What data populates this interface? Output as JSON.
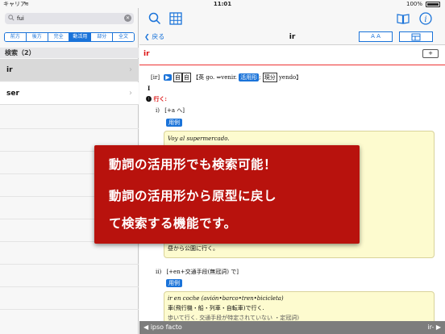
{
  "status": {
    "carrier": "キャリア",
    "time": "11:01",
    "battery": "100%"
  },
  "search": {
    "value": "fui",
    "placeholder": ""
  },
  "segments": [
    "前方",
    "後方",
    "完全",
    "動活用",
    "部分",
    "全文"
  ],
  "results": {
    "header": "検索（2）",
    "items": [
      "ir",
      "ser"
    ]
  },
  "nav": {
    "back": "戻る",
    "title": "ir",
    "font_button": "A A"
  },
  "entry": {
    "headword": "ir",
    "pron": "[ir]",
    "line1_tail": "【英 go. ⇔venir.",
    "conj_tag": "活用形",
    "gen_tag": "現分",
    "gen_form": "yendo】",
    "marker": "I",
    "sense1_num": "❶",
    "sense1": "行く:",
    "sub_i": "i)",
    "sub_i_pattern": "[+a へ]",
    "example_btn": "用例",
    "example1_es": "Voy al supermercado.",
    "example_hidden": "昼から公園に行く。",
    "sub_ii": "ii)",
    "sub_ii_pattern": "[+en+交通手段(無冠詞) で]",
    "example2_es": "ir en coche (avión•barco•tren•bicicleta)",
    "example2_jp": "車(飛行機・船・列車・自転車)で行く.",
    "example3_partial": "歩いて行く. 交通手段が特定されていない ・定冠詞)"
  },
  "bottom": {
    "prev": "◀ ipso facto",
    "next": "ir- ▶"
  },
  "overlay": {
    "line1": "動詞の活用形でも検索可能！",
    "line2": "動詞の活用形から原型に戻し",
    "line3": "て検索する機能です。"
  },
  "colors": {
    "accent": "#1a73d9",
    "headword": "#d11111",
    "overlay": "#b8120d",
    "example_bg": "#fdfbcf"
  }
}
